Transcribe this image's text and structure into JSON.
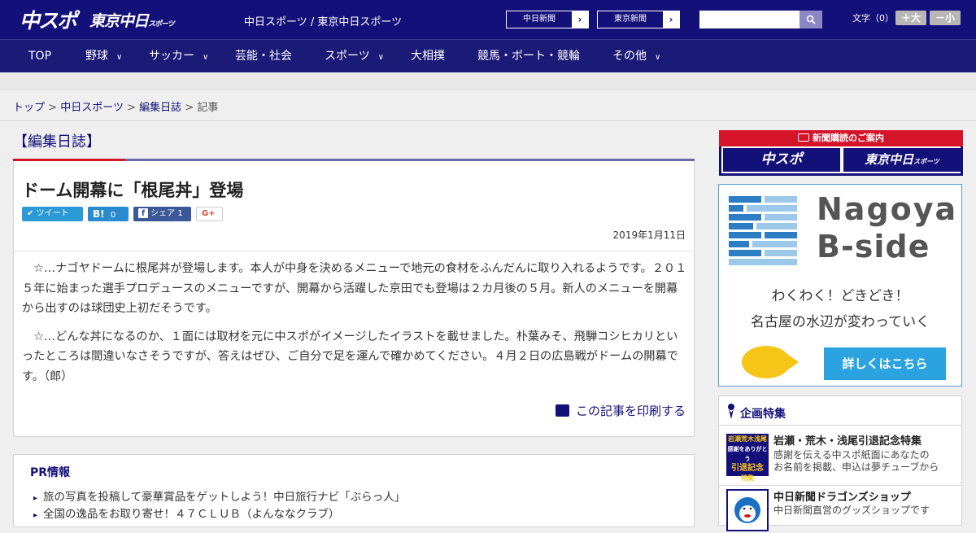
{
  "header": {
    "logo_chuspo": "中スポ",
    "logo_tokyo_main": "東京中日",
    "logo_tokyo_sub": "スポーツ",
    "site_title": "中日スポーツ / 東京中日スポーツ",
    "paper_links": [
      {
        "label": "中日新聞",
        "arrow": "›"
      },
      {
        "label": "東京新聞",
        "arrow": "›"
      }
    ],
    "search": {
      "placeholder": "",
      "button_icon": "search-icon"
    },
    "font_size_label": "文字（0）",
    "font_larger": "＋大",
    "font_smaller": "－小"
  },
  "nav": {
    "items": [
      {
        "label": "TOP",
        "has_menu": false
      },
      {
        "label": "野球",
        "has_menu": true
      },
      {
        "label": "サッカー",
        "has_menu": true
      },
      {
        "label": "芸能・社会",
        "has_menu": false
      },
      {
        "label": "スポーツ",
        "has_menu": true
      },
      {
        "label": "大相撲",
        "has_menu": false
      },
      {
        "label": "競馬・ボート・競輪",
        "has_menu": false
      },
      {
        "label": "その他",
        "has_menu": true
      }
    ],
    "chevron": "∨"
  },
  "breadcrumb": {
    "items": [
      "トップ",
      "中日スポーツ",
      "編集日誌"
    ],
    "current": "記事",
    "separator": ">"
  },
  "category_heading": "【編集日誌】",
  "article": {
    "headline": "ドーム開幕に「根尾丼」登場",
    "share": {
      "tweet": "ツイート",
      "hatena_count": "0",
      "facebook_label": "シェア",
      "facebook_count": "1",
      "gplus": "G+"
    },
    "date": "2019年1月11日",
    "paragraphs": [
      "　☆…ナゴヤドームに根尾丼が登場します。本人が中身を決めるメニューで地元の食材をふんだんに取り入れるようです。２０１５年に始まった選手プロデュースのメニューですが、開幕から活躍した京田でも登場は２カ月後の５月。新人のメニューを開幕から出すのは球団史上初だそうです。",
      "　☆…どんな丼になるのか、１面には取材を元に中スポがイメージしたイラストを載せました。朴葉みそ、飛騨コシヒカリといったところは間違いなさそうですが、答えはぜひ、ご自分で足を運んで確かめてください。４月２日の広島戦がドームの開幕です。（郎）"
    ],
    "print_label": "この記事を印刷する"
  },
  "pr": {
    "title": "PR情報",
    "items": [
      "旅の写真を投稿して豪華賞品をゲットしよう！中日旅行ナビ「ぶらっ人」",
      "全国の逸品をお取り寄せ！４７ＣＬＵＢ（よんななクラブ）"
    ]
  },
  "sidebar": {
    "subscribe": {
      "bar_label": "新聞購読のご案内",
      "chuspo": "中スポ",
      "tokyo": "東京中日",
      "tokyo_sub": "スポーツ"
    },
    "ad": {
      "line1": "Nagoya",
      "line2": "B-side",
      "tagline1": "わくわく！どきどき！",
      "tagline2": "名古屋の水辺が変わっていく",
      "cta": "詳しくはこちら"
    },
    "feature": {
      "title": "企画特集",
      "items": [
        {
          "title": "岩瀬・荒木・浅尾引退記念特集",
          "desc1": "感謝を伝える中スポ紙面にあなたの",
          "desc2": "お名前を掲載、申込は夢チューブから",
          "thumb_lines": [
            "岩瀬荒木浅尾",
            "感謝をありがとう",
            "引退記念",
            "特集"
          ]
        },
        {
          "title": "中日新聞ドラゴンズショップ",
          "desc1": "中日新聞直営のグッズショップです",
          "desc2": "",
          "thumb_lines": []
        }
      ]
    }
  },
  "colors": {
    "brand_navy": "#14107a",
    "accent_red": "#d5142a",
    "ad_blue": "#2aa3e0",
    "tweet_blue": "#2c9ad6",
    "hatena_blue": "#2a8ad0",
    "facebook_blue": "#3b5998"
  }
}
